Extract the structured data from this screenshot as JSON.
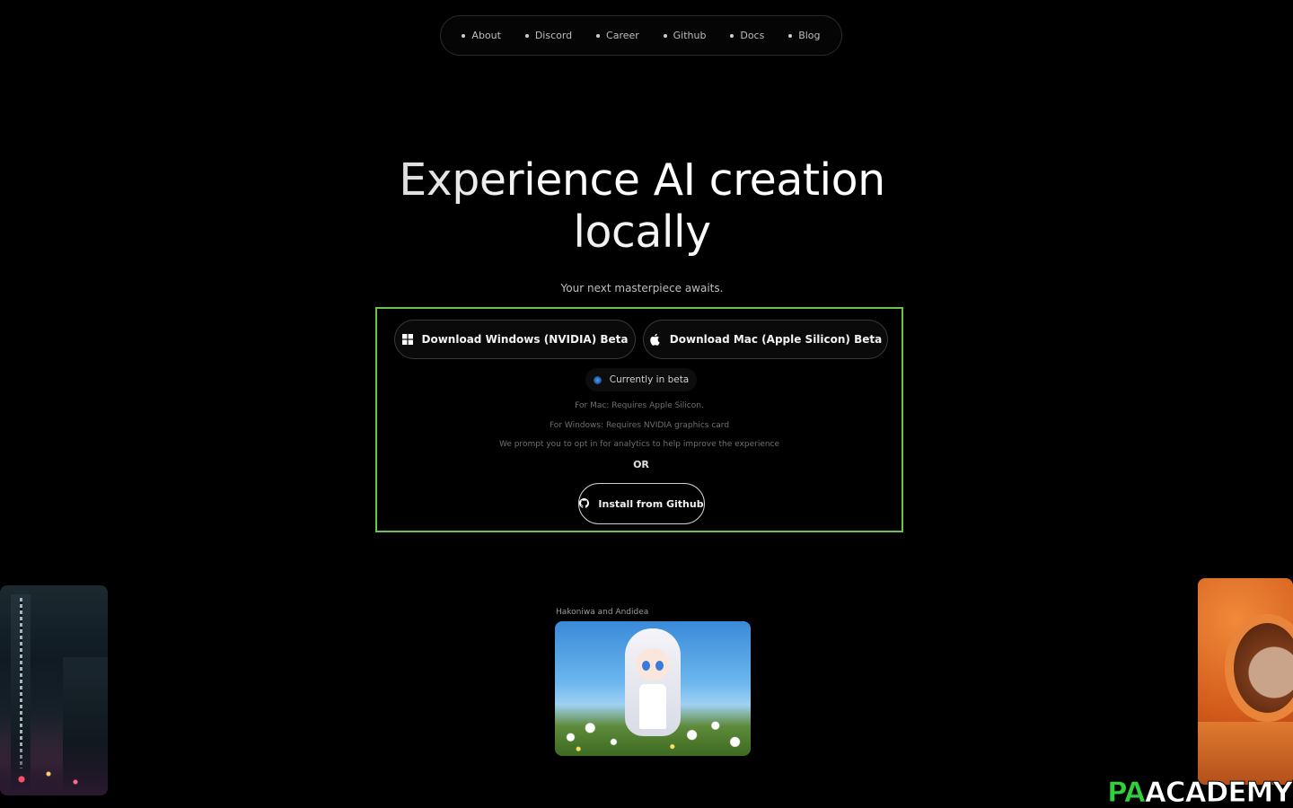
{
  "nav": {
    "items": [
      {
        "label": "About"
      },
      {
        "label": "Discord"
      },
      {
        "label": "Career"
      },
      {
        "label": "Github"
      },
      {
        "label": "Docs"
      },
      {
        "label": "Blog"
      }
    ]
  },
  "hero": {
    "title_line1": "Experience AI creation",
    "title_line2": "locally",
    "subtitle": "Your next masterpiece awaits."
  },
  "downloads": {
    "windows_label": "Download Windows (NVIDIA) Beta",
    "mac_label": "Download Mac (Apple Silicon) Beta",
    "beta_badge": "Currently in beta",
    "req_mac": "For Mac: Requires Apple Silicon.",
    "req_windows": "For Windows: Requires NVIDIA graphics card",
    "analytics_note": "We prompt you to opt in for analytics to help improve the experience",
    "or_label": "OR",
    "github_label": "Install from Github"
  },
  "gallery": {
    "center_caption": "Hakoniwa and Andidea"
  },
  "watermark": {
    "part1": "PA",
    "part2": "ACADEMY"
  },
  "colors": {
    "background": "#000000",
    "highlight": "#6cc24a",
    "watermark_green": "#2fd13a"
  }
}
